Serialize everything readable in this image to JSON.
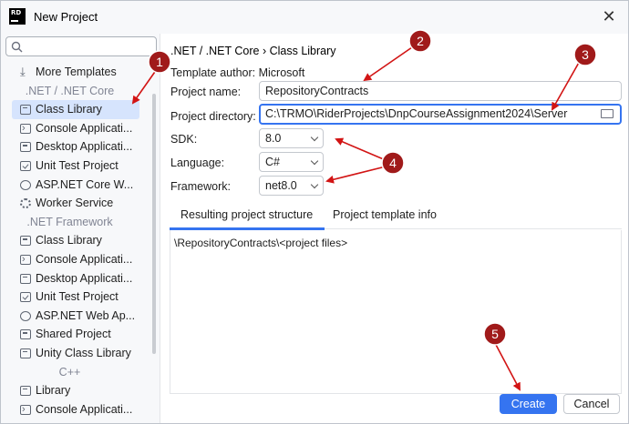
{
  "window": {
    "title": "New Project",
    "logo_text": "RD"
  },
  "sidebar": {
    "search_placeholder": "",
    "more_templates": "More Templates",
    "groups": {
      "dotnet_core": ".NET / .NET Core",
      "dotnet_framework": ".NET Framework",
      "cpp": "C++"
    },
    "core_items": [
      {
        "label": "Class Library",
        "icon": "class-library-icon",
        "selected": true
      },
      {
        "label": "Console Applicati...",
        "icon": "console-icon"
      },
      {
        "label": "Desktop Applicati...",
        "icon": "desktop-icon"
      },
      {
        "label": "Unit Test Project",
        "icon": "unit-test-icon"
      },
      {
        "label": "ASP.NET Core W...",
        "icon": "globe-icon"
      },
      {
        "label": "Worker Service",
        "icon": "gear-icon"
      }
    ],
    "framework_items": [
      {
        "label": "Class Library",
        "icon": "class-library-icon"
      },
      {
        "label": "Console Applicati...",
        "icon": "console-icon"
      },
      {
        "label": "Desktop Applicati...",
        "icon": "desktop-icon"
      },
      {
        "label": "Unit Test Project",
        "icon": "unit-test-icon"
      },
      {
        "label": "ASP.NET Web Ap...",
        "icon": "globe-icon"
      },
      {
        "label": "Shared Project",
        "icon": "shared-icon"
      },
      {
        "label": "Unity Class Library",
        "icon": "unity-icon"
      }
    ],
    "cpp_items": [
      {
        "label": "Library",
        "icon": "class-library-icon"
      },
      {
        "label": "Console Applicati...",
        "icon": "console-icon"
      }
    ]
  },
  "main": {
    "breadcrumb": ".NET / .NET Core › Class Library",
    "template_author_label": "Template author:",
    "template_author": "Microsoft",
    "project_name_label": "Project name:",
    "project_name": "RepositoryContracts",
    "project_directory_label": "Project directory:",
    "project_directory": "C:\\TRMO\\RiderProjects\\DnpCourseAssignment2024\\Server",
    "sdk_label": "SDK:",
    "sdk": "8.0",
    "language_label": "Language:",
    "language": "C#",
    "framework_label": "Framework:",
    "framework": "net8.0",
    "tabs": [
      "Resulting project structure",
      "Project template info"
    ],
    "structure_text": "\\RepositoryContracts\\<project files>",
    "create_label": "Create",
    "cancel_label": "Cancel"
  },
  "annotations": {
    "labels": [
      "1",
      "2",
      "3",
      "4",
      "5"
    ],
    "badge_color": "#a01a1a",
    "arrow_color": "#d21414"
  }
}
